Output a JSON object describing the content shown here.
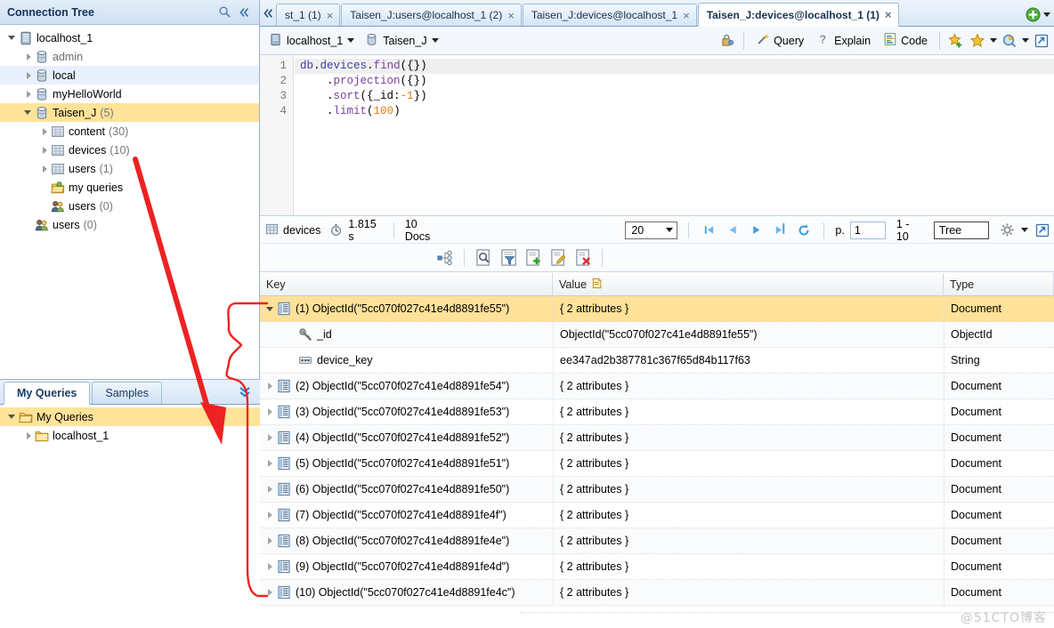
{
  "left_panel": {
    "title": "Connection Tree",
    "search_icon": "search-icon",
    "collapse_icon": "collapse-left-icon",
    "tree": [
      {
        "label": "localhost_1",
        "count": "",
        "icon": "server-icon",
        "depth": 0,
        "twist": "open",
        "state": "normal"
      },
      {
        "label": "admin",
        "count": "",
        "icon": "database-icon",
        "depth": 1,
        "twist": "closed",
        "state": "dim"
      },
      {
        "label": "local",
        "count": "",
        "icon": "database-icon",
        "depth": 1,
        "twist": "closed",
        "state": "hover"
      },
      {
        "label": "myHelloWorld",
        "count": "",
        "icon": "database-icon",
        "depth": 1,
        "twist": "closed",
        "state": "normal"
      },
      {
        "label": "Taisen_J",
        "count": "(5)",
        "icon": "database-icon",
        "depth": 1,
        "twist": "open",
        "state": "selected"
      },
      {
        "label": "content",
        "count": "(30)",
        "icon": "collection-icon",
        "depth": 2,
        "twist": "closed",
        "state": "normal"
      },
      {
        "label": "devices",
        "count": "(10)",
        "icon": "collection-icon",
        "depth": 2,
        "twist": "closed",
        "state": "normal"
      },
      {
        "label": "users",
        "count": "(1)",
        "icon": "collection-icon",
        "depth": 2,
        "twist": "closed",
        "state": "normal"
      },
      {
        "label": "my queries",
        "count": "",
        "icon": "folder-queries-icon",
        "depth": 2,
        "twist": "none",
        "state": "normal"
      },
      {
        "label": "users",
        "count": "(0)",
        "icon": "users-icon",
        "depth": 2,
        "twist": "none",
        "state": "normal"
      },
      {
        "label": "users",
        "count": "(0)",
        "icon": "users-icon",
        "depth": 1,
        "twist": "none",
        "state": "normal"
      }
    ]
  },
  "queries_panel": {
    "tabs": [
      {
        "label": "My Queries",
        "active": true
      },
      {
        "label": "Samples",
        "active": false
      }
    ],
    "expand_icon": "chevron-double-down-icon",
    "tree": [
      {
        "label": "My Queries",
        "icon": "folder-open-icon",
        "depth": 0,
        "twist": "open",
        "state": "selected"
      },
      {
        "label": "localhost_1",
        "icon": "folder-icon",
        "depth": 1,
        "twist": "closed",
        "state": "normal"
      }
    ]
  },
  "editor_tabs": {
    "collapse_icon": "collapse-tabs-icon",
    "items": [
      {
        "label": "st_1 (1)",
        "active": false,
        "close": "×"
      },
      {
        "label": "Taisen_J:users@localhost_1 (2)",
        "active": false,
        "close": "×"
      },
      {
        "label": "Taisen_J:devices@localhost_1",
        "active": false,
        "close": "×"
      },
      {
        "label": "Taisen_J:devices@localhost_1 (1)",
        "active": true,
        "close": "×"
      }
    ],
    "new_tab_icon": "add-green-icon",
    "new_tab_dropdown": "chevron-down-icon"
  },
  "editor_toolbar": {
    "connection": {
      "label": "localhost_1",
      "icon": "server-icon",
      "caret": "▾"
    },
    "database": {
      "label": "Taisen_J",
      "icon": "database-icon",
      "caret": "▾"
    },
    "lock_icon": "auth-lock-icon",
    "buttons": [
      {
        "label": "Query",
        "icon": "wand-icon"
      },
      {
        "label": "Explain",
        "icon": "question-icon"
      },
      {
        "label": "Code",
        "icon": "code-icon"
      }
    ],
    "icons": [
      {
        "name": "add-favorite-icon"
      },
      {
        "name": "favorite-star-icon"
      },
      {
        "name": "chevron-down-icon"
      },
      {
        "name": "profiler-icon"
      },
      {
        "name": "chevron-down-icon-2"
      },
      {
        "name": "export-icon"
      }
    ]
  },
  "code": {
    "gutter": [
      "1",
      "2",
      "3",
      "4"
    ],
    "lines": [
      [
        {
          "t": "db",
          "c": "obj"
        },
        {
          "t": ".",
          "c": "punct"
        },
        {
          "t": "devices",
          "c": "obj"
        },
        {
          "t": ".",
          "c": "punct"
        },
        {
          "t": "find",
          "c": "fn"
        },
        {
          "t": "({})",
          "c": "punct"
        }
      ],
      [
        {
          "t": "    .",
          "c": "punct"
        },
        {
          "t": "projection",
          "c": "fn"
        },
        {
          "t": "({})",
          "c": "punct"
        }
      ],
      [
        {
          "t": "    .",
          "c": "punct"
        },
        {
          "t": "sort",
          "c": "fn"
        },
        {
          "t": "({_id:",
          "c": "punct"
        },
        {
          "t": "-1",
          "c": "num"
        },
        {
          "t": "})",
          "c": "punct"
        }
      ],
      [
        {
          "t": "    .",
          "c": "punct"
        },
        {
          "t": "limit",
          "c": "fn"
        },
        {
          "t": "(",
          "c": "punct"
        },
        {
          "t": "100",
          "c": "num"
        },
        {
          "t": ")",
          "c": "punct"
        }
      ]
    ]
  },
  "results_toolbar": {
    "collection_icon": "collection-icon",
    "collection": "devices",
    "timer_icon": "timer-icon",
    "duration": "1.815 s",
    "docs": "10 Docs",
    "page_size": "20",
    "nav": [
      {
        "name": "first-page-button",
        "glyph": "first"
      },
      {
        "name": "prev-page-button",
        "glyph": "prev"
      },
      {
        "name": "next-page-button",
        "glyph": "next"
      },
      {
        "name": "last-page-button",
        "glyph": "last"
      },
      {
        "name": "refresh-button",
        "glyph": "refresh"
      }
    ],
    "page_label": "p.",
    "page_value": "1",
    "range": "1 - 10",
    "view_mode": "Tree",
    "settings_icon": "gear-icon",
    "settings_caret": "chevron-down-icon",
    "export_icon": "export-icon"
  },
  "doc_actions": [
    {
      "name": "expand-tree-button",
      "icon": "hierarchy-icon"
    },
    {
      "name": "view-document-button",
      "icon": "magnifier-doc-icon"
    },
    {
      "name": "filter-document-button",
      "icon": "filter-doc-icon"
    },
    {
      "name": "insert-document-button",
      "icon": "add-doc-icon"
    },
    {
      "name": "edit-document-button",
      "icon": "edit-doc-icon"
    },
    {
      "name": "delete-document-button",
      "icon": "delete-doc-icon"
    }
  ],
  "table": {
    "columns": [
      {
        "label": "Key",
        "icon": ""
      },
      {
        "label": "Value",
        "icon": "value-note-icon"
      },
      {
        "label": "Type",
        "icon": ""
      }
    ],
    "rows": [
      {
        "depth": 0,
        "twist": "open",
        "icon": "document-icon",
        "key": "(1) ObjectId(\"5cc070f027c41e4d8891fe55\")",
        "value": "{ 2 attributes }",
        "type": "Document",
        "selected": true
      },
      {
        "depth": 1,
        "twist": "none",
        "icon": "key-icon",
        "key": "_id",
        "value": "ObjectId(\"5cc070f027c41e4d8891fe55\")",
        "type": "ObjectId",
        "selected": false
      },
      {
        "depth": 1,
        "twist": "none",
        "icon": "string-icon",
        "key": "device_key",
        "value": "ee347ad2b387781c367f65d84b117f63",
        "type": "String",
        "selected": false
      },
      {
        "depth": 0,
        "twist": "closed",
        "icon": "document-icon",
        "key": "(2) ObjectId(\"5cc070f027c41e4d8891fe54\")",
        "value": "{ 2 attributes }",
        "type": "Document",
        "selected": false
      },
      {
        "depth": 0,
        "twist": "closed",
        "icon": "document-icon",
        "key": "(3) ObjectId(\"5cc070f027c41e4d8891fe53\")",
        "value": "{ 2 attributes }",
        "type": "Document",
        "selected": false
      },
      {
        "depth": 0,
        "twist": "closed",
        "icon": "document-icon",
        "key": "(4) ObjectId(\"5cc070f027c41e4d8891fe52\")",
        "value": "{ 2 attributes }",
        "type": "Document",
        "selected": false
      },
      {
        "depth": 0,
        "twist": "closed",
        "icon": "document-icon",
        "key": "(5) ObjectId(\"5cc070f027c41e4d8891fe51\")",
        "value": "{ 2 attributes }",
        "type": "Document",
        "selected": false
      },
      {
        "depth": 0,
        "twist": "closed",
        "icon": "document-icon",
        "key": "(6) ObjectId(\"5cc070f027c41e4d8891fe50\")",
        "value": "{ 2 attributes }",
        "type": "Document",
        "selected": false
      },
      {
        "depth": 0,
        "twist": "closed",
        "icon": "document-icon",
        "key": "(7) ObjectId(\"5cc070f027c41e4d8891fe4f\")",
        "value": "{ 2 attributes }",
        "type": "Document",
        "selected": false
      },
      {
        "depth": 0,
        "twist": "closed",
        "icon": "document-icon",
        "key": "(8) ObjectId(\"5cc070f027c41e4d8891fe4e\")",
        "value": "{ 2 attributes }",
        "type": "Document",
        "selected": false
      },
      {
        "depth": 0,
        "twist": "closed",
        "icon": "document-icon",
        "key": "(9) ObjectId(\"5cc070f027c41e4d8891fe4d\")",
        "value": "{ 2 attributes }",
        "type": "Document",
        "selected": false
      },
      {
        "depth": 0,
        "twist": "closed",
        "icon": "document-icon",
        "key": "(10) ObjectId(\"5cc070f027c41e4d8891fe4c\")",
        "value": "{ 2 attributes }",
        "type": "Document",
        "selected": false
      }
    ]
  },
  "annotation": {
    "color": "#ee2222",
    "arrow_name": "red-arrow-annotation",
    "bracket_name": "red-brace-annotation"
  },
  "watermark": "@51CTO博客",
  "colors": {
    "selection_yellow": "#ffe199",
    "hover_blue": "#e8f0fb",
    "header_blue": "#cfe0f2",
    "accent_red": "#ee2222",
    "nav_blue": "#5aa9e6"
  }
}
